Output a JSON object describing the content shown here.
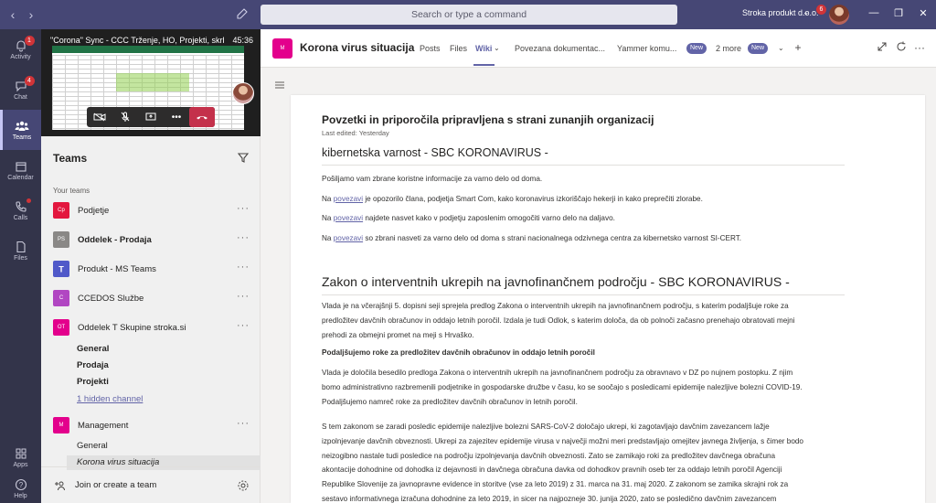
{
  "titlebar": {
    "search_placeholder": "Search or type a command",
    "org_name": "Stroka produkt d.o.o.",
    "notification_count": "6"
  },
  "appbar": {
    "items": [
      {
        "label": "Activity",
        "badge": "1",
        "icon": "bell-icon"
      },
      {
        "label": "Chat",
        "badge": "4",
        "icon": "chat-icon"
      },
      {
        "label": "Teams",
        "badge": "",
        "icon": "teams-icon"
      },
      {
        "label": "Calendar",
        "badge": "",
        "icon": "calendar-icon"
      },
      {
        "label": "Calls",
        "badge": "",
        "icon": "phone-icon"
      },
      {
        "label": "Files",
        "badge": "",
        "icon": "file-icon"
      }
    ],
    "apps_label": "Apps",
    "help_label": "Help"
  },
  "call": {
    "title": "\"Corona\" Sync - CCC Trženje, HO, Projekti, skrb...",
    "time": "45:36"
  },
  "panel": {
    "header": "Teams",
    "section_label": "Your teams",
    "join_label": "Join or create a team"
  },
  "teams": [
    {
      "initials": "Cp",
      "name": "Podjetje",
      "color": "#e3173e",
      "bold": false
    },
    {
      "initials": "PS",
      "name": "Oddelek - Prodaja",
      "color": "#8a8886",
      "bold": true
    },
    {
      "initials": "",
      "name": "Produkt - MS Teams",
      "color": "#5059c9",
      "bold": false
    },
    {
      "initials": "C",
      "name": "CCEDOS Službe",
      "color": "#b146c2",
      "bold": false
    },
    {
      "initials": "OT",
      "name": "Oddelek T Skupine stroka.si",
      "color": "#e3008c",
      "bold": false
    },
    {
      "initials": "M",
      "name": "Management",
      "color": "#e3008c",
      "bold": false
    }
  ],
  "channels_oddelek": [
    "General",
    "Prodaja",
    "Projekti"
  ],
  "hidden_channels": "1 hidden channel",
  "channels_management": [
    "General",
    "Korona virus situacija"
  ],
  "channel_header": {
    "avatar": "M",
    "title": "Korona virus situacija",
    "tabs": [
      "Posts",
      "Files",
      "Wiki",
      "Povezana dokumentac...",
      "Yammer komu...",
      "2 more"
    ],
    "new_badge": "New"
  },
  "wiki": {
    "title": "Povzetki in priporočila pripravljena s strani zunanjih organizacij",
    "edited": "Last edited: Yesterday",
    "section1_title": "kibernetska varnost - SBC KORONAVIRUS -",
    "s1_p1": "Pošiljamo vam zbrane koristne informacije za varno delo od doma.",
    "link_word": "povezavi",
    "na": "Na",
    "s1_p2_rest": " je opozorilo člana, podjetja Smart Com, kako koronavirus izkoriščajo hekerji in kako preprečiti zlorabe.",
    "s1_p3_rest": " najdete nasvet kako v podjetju zaposlenim omogočiti varno delo na daljavo.",
    "s1_p4_rest": " so zbrani nasveti za varno delo od doma s strani nacionalnega odzivnega centra za kibernetsko varnost SI-CERT.",
    "section2_title": "Zakon o interventnih ukrepih na javnofinančnem področju - SBC KORONAVIRUS -",
    "s2_p1": [
      "Vlada je na včerajšnji 5. dopisni seji sprejela predlog Zakona o interventnih ukrepih na javnofinančnem področju, s katerim podaljšuje roke za",
      "predložitev davčnih obračunov in oddajo letnih poročil. Izdala je tudi Odlok, s katerim določa, da ob polnoči začasno prenehajo obratovati mejni",
      "prehodi za obmejni promet na meji s Hrvaško."
    ],
    "s2_subhead": "Podaljšujemo roke za predložitev davčnih obračunov in oddajo letnih poročil",
    "s2_p2": [
      "Vlada je določila besedilo predloga Zakona o interventnih ukrepih na javnofinančnem področju za obravnavo v DZ po nujnem postopku. Z njim",
      "bomo administrativno razbremenili podjetnike in gospodarske družbe v času, ko se soočajo s posledicami epidemije nalezljive bolezni COVID-19.",
      "Podaljšujemo namreč roke za predložitev davčnih obračunov in letnih poročil."
    ],
    "s2_p3": [
      "S tem zakonom se zaradi posledic epidemije nalezljive bolezni SARS-CoV-2 določajo ukrepi, ki zagotavljajo davčnim zavezancem lažje",
      "izpolnjevanje davčnih obveznosti. Ukrepi za zajezitev epidemije virusa v največji možni meri predstavljajo omejitev javnega življenja, s čimer bodo",
      "neizogibno nastale tudi posledice na področju izpolnjevanja davčnih obveznosti. Zato se zamikajo roki za predložitev davčnega obračuna",
      "akontacije dohodnine od dohodka iz dejavnosti in davčnega obračuna davka od dohodkov pravnih oseb ter za oddajo letnih poročil Agenciji",
      "Republike Slovenije za javnopravne evidence in storitve (vse za leto 2019) z 31. marca na 31. maj 2020. Z zakonom se zamika skrajni rok za",
      "sestavo informativnega izračuna dohodnine za leto 2019, in sicer na najpozneje 30. junija 2020, zato se posledično davčnim zavezancem"
    ]
  },
  "colors": {
    "titlebar": "#464775",
    "appbar": "#33344a",
    "accent": "#6264a7",
    "hangup": "#c4314b"
  }
}
